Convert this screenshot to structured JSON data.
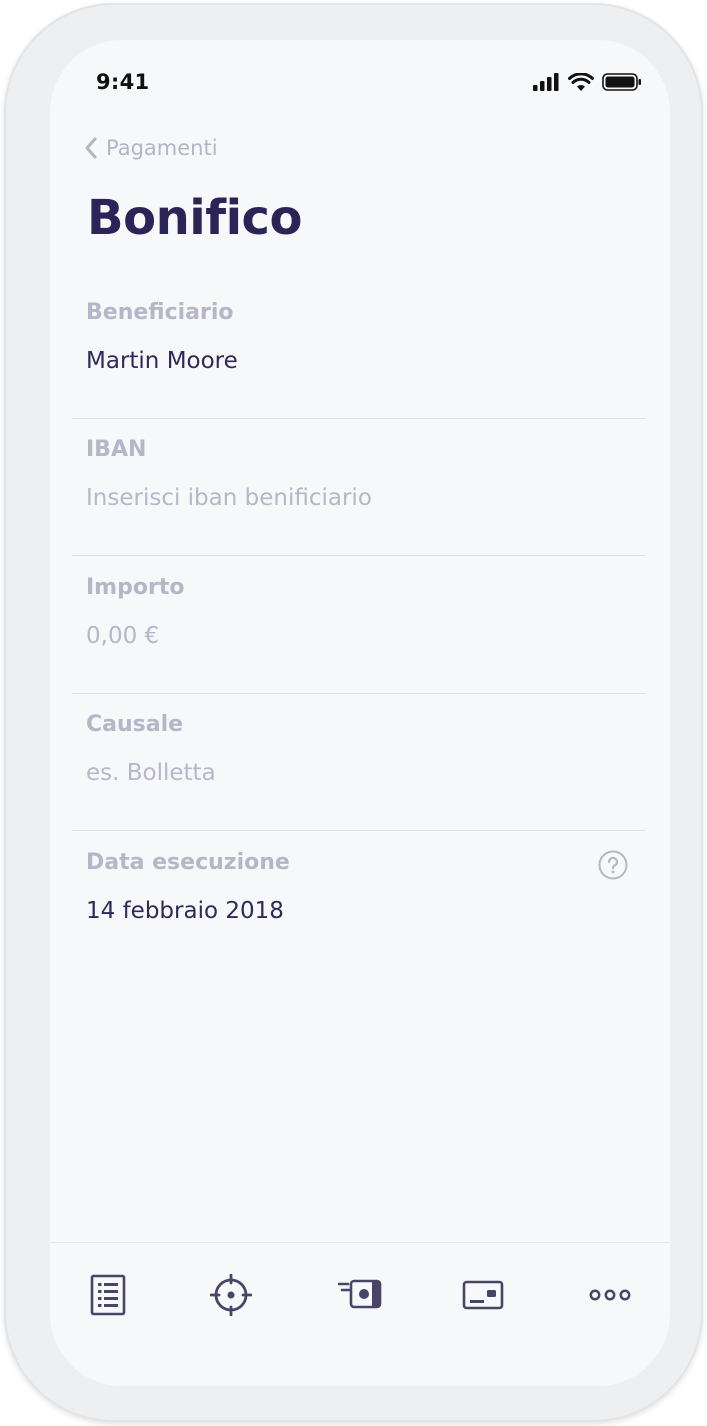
{
  "status_bar": {
    "time": "9:41"
  },
  "nav": {
    "back_label": "Pagamenti"
  },
  "page": {
    "title": "Bonifico"
  },
  "fields": [
    {
      "label": "Beneficiario",
      "value": "Martin Moore",
      "is_placeholder": false
    },
    {
      "label": "IBAN",
      "value": "Inserisci iban benificiario",
      "is_placeholder": true
    },
    {
      "label": "Importo",
      "value": "0,00 €",
      "is_placeholder": true
    },
    {
      "label": "Causale",
      "value": "es. Bolletta",
      "is_placeholder": true
    },
    {
      "label": "Data esecuzione",
      "value": "14 febbraio 2018",
      "is_placeholder": false
    }
  ],
  "tabbar": {
    "items": [
      {
        "icon": "document-list-icon"
      },
      {
        "icon": "target-icon"
      },
      {
        "icon": "money-transfer-icon"
      },
      {
        "icon": "card-icon"
      },
      {
        "icon": "more-dots-icon"
      }
    ]
  },
  "colors": {
    "title": "#2c2357",
    "label": "#b7b5c8",
    "value": "#2f2a57",
    "icon": "#4a4568"
  }
}
